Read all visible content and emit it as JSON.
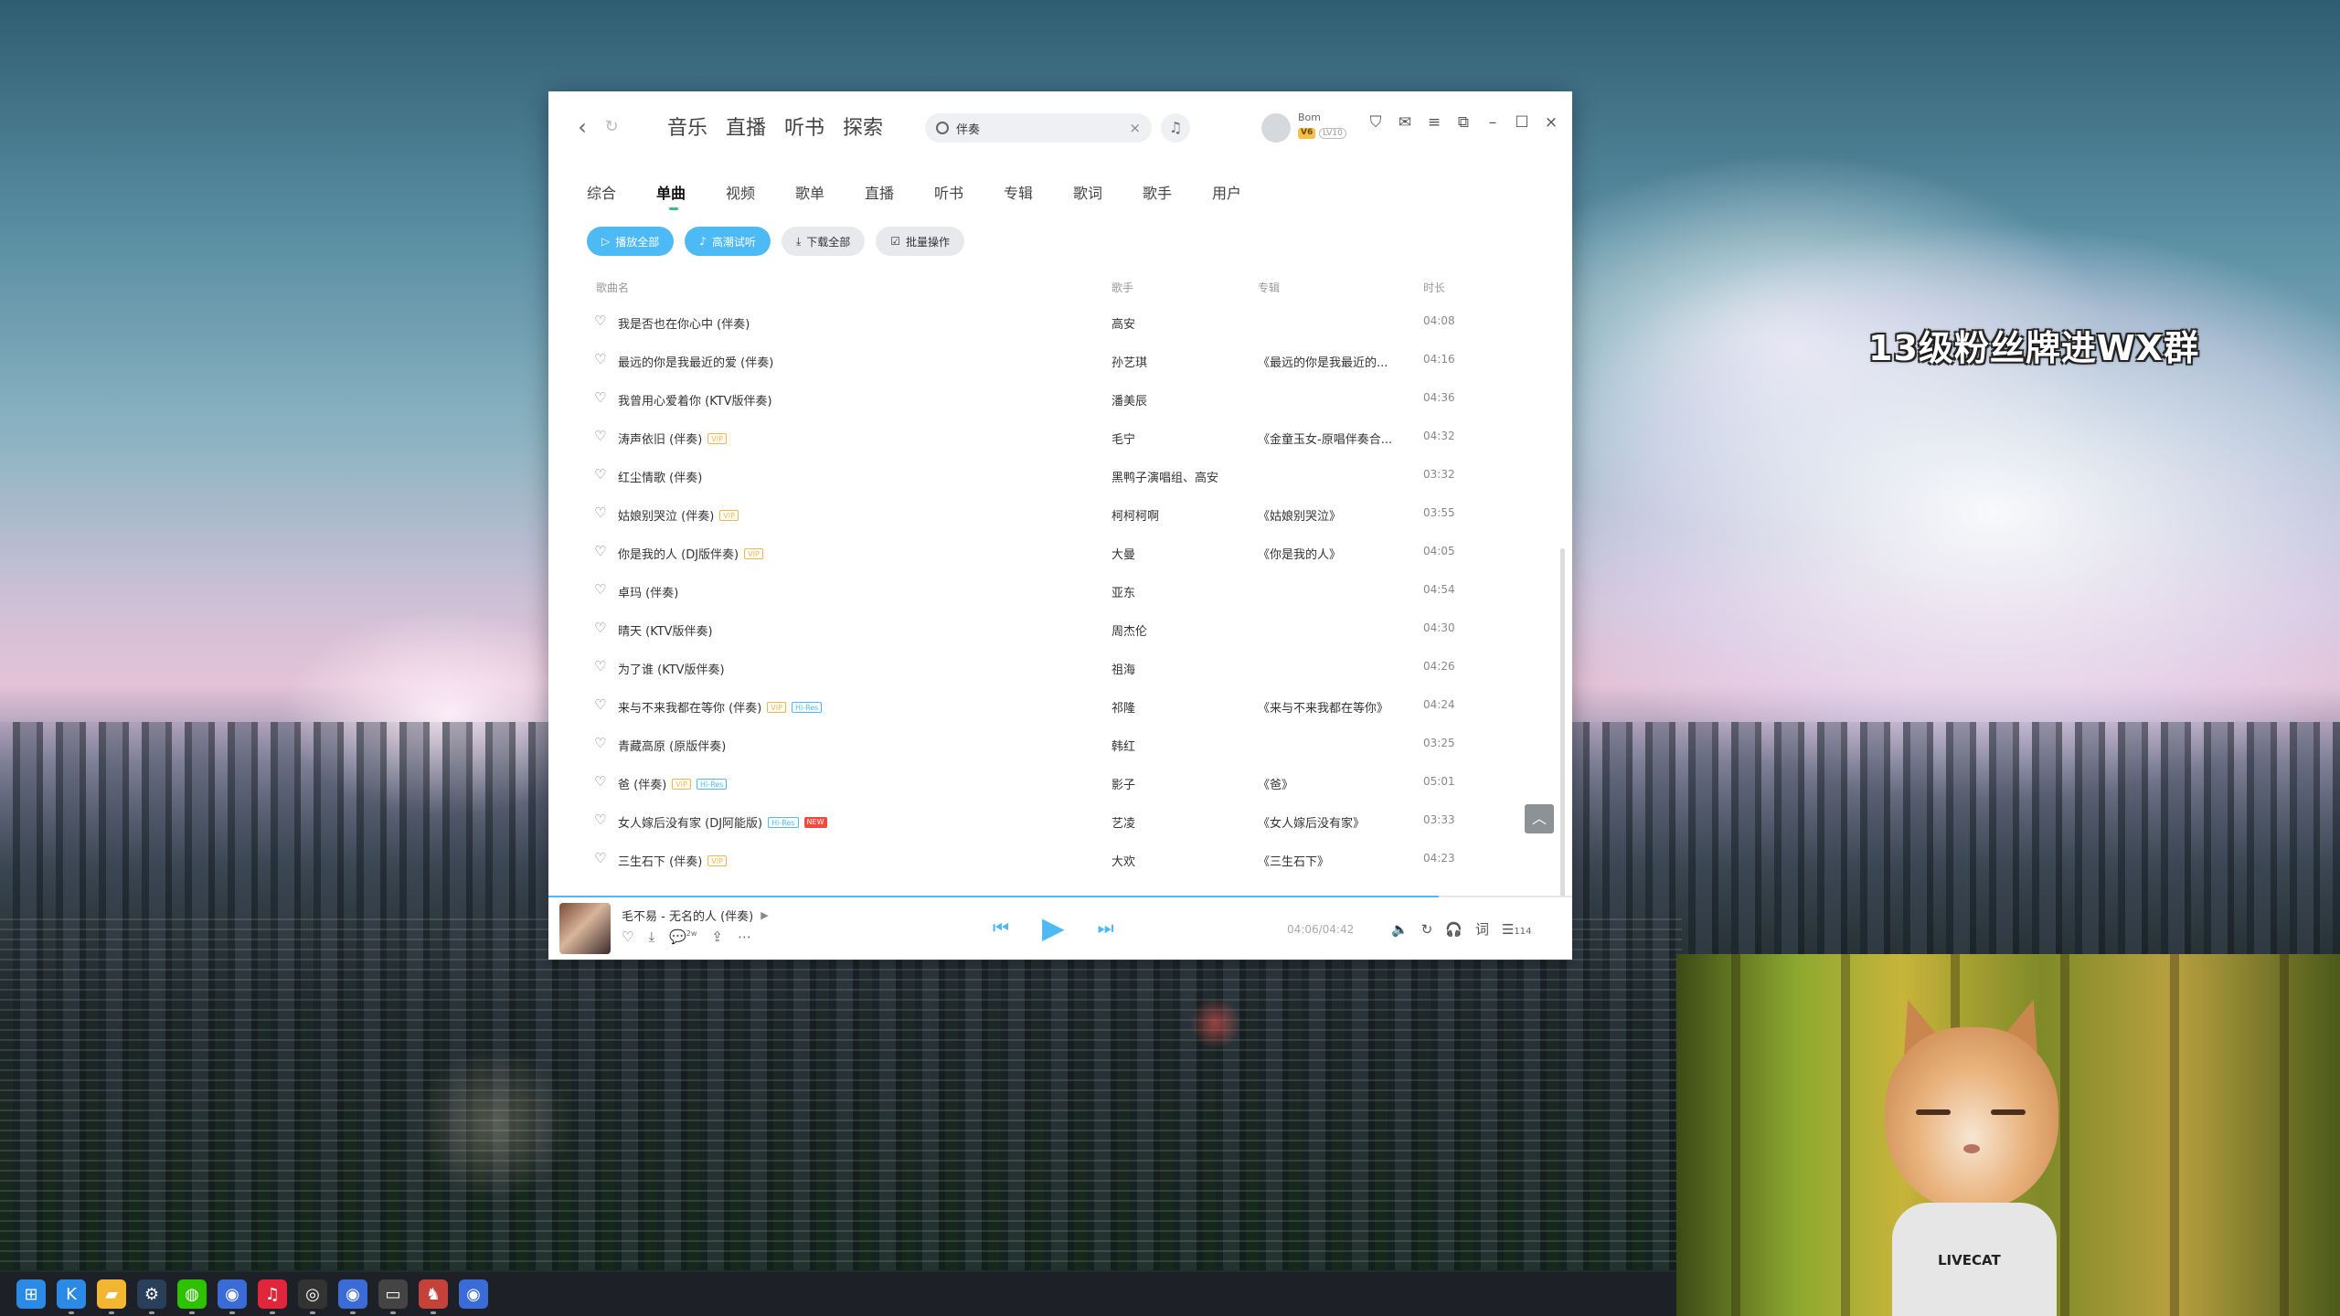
{
  "overlay_text": "13级粉丝牌进WX群",
  "window": {
    "main_nav": [
      "音乐",
      "直播",
      "听书",
      "探索"
    ],
    "search": {
      "value": "伴奏",
      "placeholder": ""
    },
    "user": {
      "name": "Bom",
      "vip": "V6",
      "level": "LV10"
    },
    "tabs": [
      "综合",
      "单曲",
      "视频",
      "歌单",
      "直播",
      "听书",
      "专辑",
      "歌词",
      "歌手",
      "用户"
    ],
    "active_tab": "单曲",
    "actions": {
      "play_all": "播放全部",
      "hires": "高潮试听",
      "download_all": "下载全部",
      "batch": "批量操作"
    },
    "columns": {
      "title": "歌曲名",
      "artist": "歌手",
      "album": "专辑",
      "duration": "时长"
    },
    "songs": [
      {
        "title": "我是否也在你心中 (伴奏)",
        "artist": "高安",
        "album": "",
        "duration": "04:08",
        "tags": []
      },
      {
        "title": "最远的你是我最近的爱 (伴奏)",
        "artist": "孙艺琪",
        "album": "《最远的你是我最近的...",
        "duration": "04:16",
        "tags": []
      },
      {
        "title": "我曾用心爱着你 (KTV版伴奏)",
        "artist": "潘美辰",
        "album": "",
        "duration": "04:36",
        "tags": []
      },
      {
        "title": "涛声依旧 (伴奏)",
        "artist": "毛宁",
        "album": "《金童玉女-原唱伴奏合...",
        "duration": "04:32",
        "tags": [
          "VIP"
        ]
      },
      {
        "title": "红尘情歌 (伴奏)",
        "artist": "黑鸭子演唱组、高安",
        "album": "",
        "duration": "03:32",
        "tags": []
      },
      {
        "title": "姑娘别哭泣 (伴奏)",
        "artist": "柯柯柯啊",
        "album": "《姑娘别哭泣》",
        "duration": "03:55",
        "tags": [
          "VIP"
        ]
      },
      {
        "title": "你是我的人 (DJ版伴奏)",
        "artist": "大曼",
        "album": "《你是我的人》",
        "duration": "04:05",
        "tags": [
          "VIP"
        ]
      },
      {
        "title": "卓玛 (伴奏)",
        "artist": "亚东",
        "album": "",
        "duration": "04:54",
        "tags": []
      },
      {
        "title": "晴天 (KTV版伴奏)",
        "artist": "周杰伦",
        "album": "",
        "duration": "04:30",
        "tags": []
      },
      {
        "title": "为了谁 (KTV版伴奏)",
        "artist": "祖海",
        "album": "",
        "duration": "04:26",
        "tags": []
      },
      {
        "title": "来与不来我都在等你 (伴奏)",
        "artist": "祁隆",
        "album": "《来与不来我都在等你》",
        "duration": "04:24",
        "tags": [
          "VIP",
          "Hi-Res"
        ]
      },
      {
        "title": "青藏高原 (原版伴奏)",
        "artist": "韩红",
        "album": "",
        "duration": "03:25",
        "tags": []
      },
      {
        "title": "爸 (伴奏)",
        "artist": "影子",
        "album": "《爸》",
        "duration": "05:01",
        "tags": [
          "VIP",
          "Hi-Res"
        ]
      },
      {
        "title": "女人嫁后没有家 (DJ阿能版)",
        "artist": "艺凌",
        "album": "《女人嫁后没有家》",
        "duration": "03:33",
        "tags": [
          "Hi-Res",
          "NEW"
        ]
      },
      {
        "title": "三生石下 (伴奏)",
        "artist": "大欢",
        "album": "《三生石下》",
        "duration": "04:23",
        "tags": [
          "VIP"
        ]
      }
    ],
    "player": {
      "now_playing": "毛不易 - 无名的人 (伴奏)",
      "time": "04:06/04:42",
      "progress": 0.87,
      "comment_count": "2w",
      "lyric_label": "词",
      "playlist_count": "114"
    }
  },
  "webcam": {
    "hoodie_text": "LIVECAT"
  },
  "taskbar": {
    "icons": [
      "windows-start-icon",
      "kugou-icon",
      "file-explorer-icon",
      "steam-icon",
      "wechat-icon",
      "app-icon",
      "netease-music-icon",
      "obs-icon",
      "app-icon",
      "terminal-icon",
      "game-icon",
      "app-icon"
    ]
  }
}
